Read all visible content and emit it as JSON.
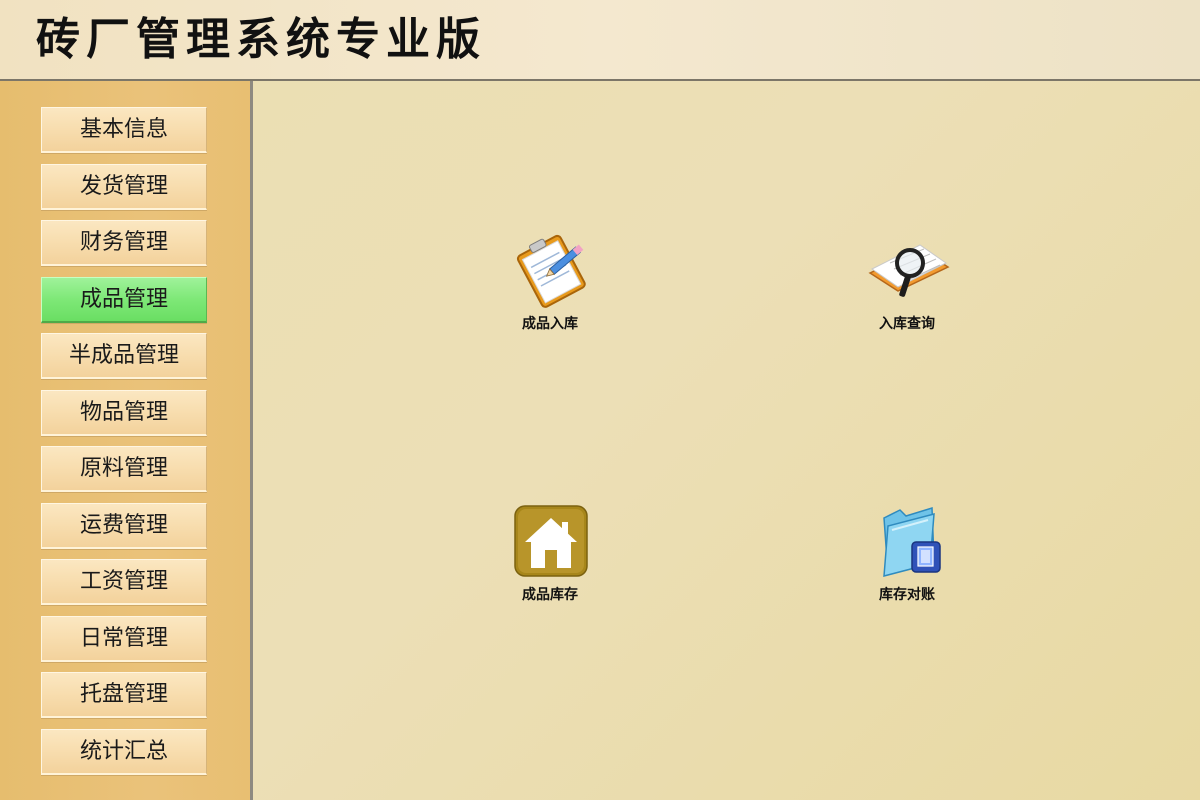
{
  "app": {
    "title": "砖厂管理系统专业版"
  },
  "sidebar": {
    "items": [
      {
        "label": "基本信息",
        "active": false
      },
      {
        "label": "发货管理",
        "active": false
      },
      {
        "label": "财务管理",
        "active": false
      },
      {
        "label": "成品管理",
        "active": true
      },
      {
        "label": "半成品管理",
        "active": false
      },
      {
        "label": "物品管理",
        "active": false
      },
      {
        "label": "原料管理",
        "active": false
      },
      {
        "label": "运费管理",
        "active": false
      },
      {
        "label": "工资管理",
        "active": false
      },
      {
        "label": "日常管理",
        "active": false
      },
      {
        "label": "托盘管理",
        "active": false
      },
      {
        "label": "统计汇总",
        "active": false
      }
    ]
  },
  "main": {
    "tiles": [
      {
        "label": "成品入库",
        "icon": "clipboard-pencil-icon"
      },
      {
        "label": "入库查询",
        "icon": "magnifier-notebook-icon"
      },
      {
        "label": "成品库存",
        "icon": "house-icon"
      },
      {
        "label": "库存对账",
        "icon": "folder-document-icon"
      }
    ]
  },
  "colors": {
    "active_item": "#7ee877",
    "sidebar_bg": "#e8bf72",
    "main_bg": "#ebdfb3"
  }
}
